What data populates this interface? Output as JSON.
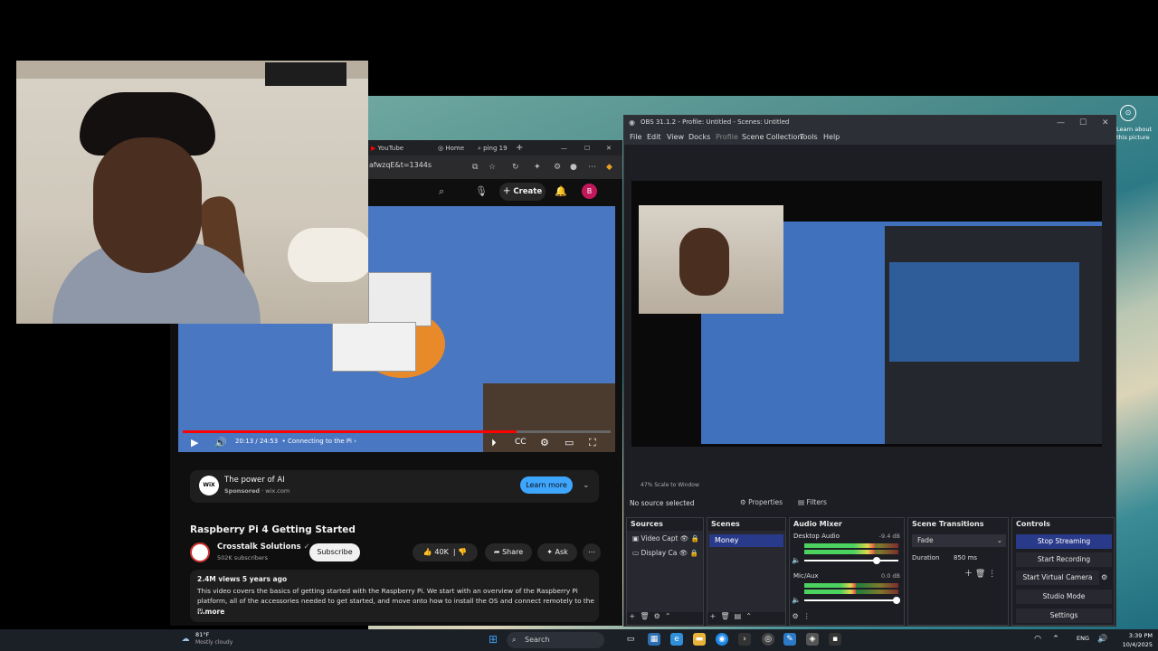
{
  "browser": {
    "tabs": [
      "YouTube",
      "Home",
      "ping 19"
    ],
    "url_fragment": "afwzqE&t=1344s",
    "create_label": "Create",
    "avatar_letter": "B"
  },
  "video": {
    "time": "20:13 / 24:53",
    "chapter": "• Connecting to the Pi",
    "progress": 0.78
  },
  "ad": {
    "logo": "WiX",
    "title": "The power of AI",
    "sponsored": "Sponsored",
    "domain": "· wix.com",
    "button": "Learn more"
  },
  "video_info": {
    "title": "Raspberry Pi 4 Getting Started",
    "channel": "Crosstalk Solutions",
    "subscribers": "502K subscribers",
    "subscribe": "Subscribe",
    "likes": "40K",
    "share": "Share",
    "ask": "Ask",
    "meta": "2.4M views  5 years ago",
    "description": "This video covers the basics of getting started with the Raspberry Pi.  We start with an overview of the Raspberry Pi platform, all of the accessories needed to get started, and move onto how to install the OS and connect remotely to the Pi.",
    "more": "...more"
  },
  "obs": {
    "title": "OBS 31.1.2 - Profile: Untitled - Scenes: Untitled",
    "menu": [
      "File",
      "Edit",
      "View",
      "Docks",
      "Profile",
      "Scene Collection",
      "Tools",
      "Help"
    ],
    "scale": "47%     Scale to Window",
    "no_source": "No source selected",
    "properties": "Properties",
    "filters": "Filters",
    "docks": {
      "sources": "Sources",
      "scenes": "Scenes",
      "mixer": "Audio Mixer",
      "transitions": "Scene Transitions",
      "controls": "Controls"
    },
    "sources": [
      "Video Capt",
      "Display Ca"
    ],
    "scenes": [
      "Money"
    ],
    "mixer": [
      {
        "name": "Desktop Audio",
        "db": "-9.4 dB",
        "level": 0.75
      },
      {
        "name": "Mic/Aux",
        "db": "0.0 dB",
        "level": 0.55
      }
    ],
    "transition": "Fade",
    "duration_label": "Duration",
    "duration_value": "850 ms",
    "controls": [
      "Stop Streaming",
      "Start Recording",
      "Start Virtual Camera",
      "Studio Mode",
      "Settings"
    ]
  },
  "pip": {
    "label": "Learn about this picture"
  },
  "taskbar": {
    "temp": "81°F",
    "weather": "Mostly cloudy",
    "search": "Search",
    "lang": "ENG",
    "time": "3:39 PM",
    "date": "10/4/2025"
  },
  "colors": {
    "youtube_red": "#ff0000",
    "obs_accent": "#2a3a8a",
    "yt_blue": "#3ea6ff"
  }
}
